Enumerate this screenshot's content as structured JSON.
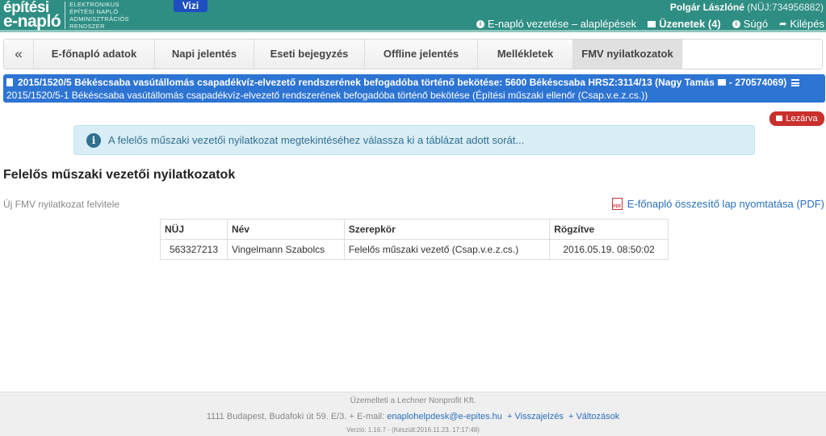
{
  "header": {
    "logo_line1": "építési",
    "logo_line2": "e-napló",
    "logo_sub1": "ELEKTRONIKUS",
    "logo_sub2": "ÉPÍTÉSI NAPLÓ",
    "logo_sub3": "ADMINISZTRÁCIÓS",
    "logo_sub4": "RENDSZER",
    "vizi": "Vizi",
    "user_name": "Polgár Lászlóné",
    "user_id": "(NÜJ:734956882)",
    "nav": {
      "guide": "E-napló vezetése – alaplépések",
      "messages": "Üzenetek (4)",
      "help": "Súgó",
      "logout": "Kilépés"
    }
  },
  "tabs": [
    "«",
    "E-főnapló adatok",
    "Napi jelentés",
    "Eseti bejegyzés",
    "Offline jelentés",
    "Mellékletek",
    "FMV nyilatkozatok"
  ],
  "project": {
    "line1": "2015/1520/5 Békéscsaba vasútállomás csapadékvíz-elvezető rendszerének befogadóba történő bekötése: 5600 Békéscsaba HRSZ:3114/13 (Nagy Tamás",
    "line1_suffix": "- 270574069)",
    "line2": "2015/1520/5-1 Békéscsaba vasútállomás csapadékvíz-elvezető rendszerének befogadóba történő bekötése (Építési műszaki ellenőr (Csap.v.e.z.cs.))"
  },
  "lock_label": "Lezárva",
  "info_text": "A felelős műszaki vezetői nyilatkozat megtekintéséhez válassza ki a táblázat adott sorát...",
  "section_title": "Felelős műszaki vezetői nyilatkozatok",
  "new_fmv": "Új FMV nyilatkozat felvitele",
  "pdf_link": "E-főnapló összesítő lap nyomtatása (PDF)",
  "table": {
    "headers": [
      "NÜJ",
      "Név",
      "Szerepkör",
      "Rögzítve"
    ],
    "rows": [
      [
        "563327213",
        "Vingelmann Szabolcs",
        "Felelős műszaki vezető (Csap.v.e.z.cs.)",
        "2016.05.19. 08:50:02"
      ]
    ]
  },
  "footer": {
    "operator": "Üzemelteti a Lechner Nonprofit Kft.",
    "address": "1111 Budapest, Budafoki út 59. E/3. + E-mail:",
    "email": "enaplohelpdesk@e-epites.hu",
    "feedback": "+ Visszajelzés",
    "changes": "+ Változások",
    "version": "Verzió: 1.16.7 - (Készült:2016.11.23. 17:17:48)"
  },
  "colors": {
    "header_bg": "#2f8e83",
    "project_bar": "#2d74d3",
    "lock": "#c9302c",
    "info_bg": "#d9edf7"
  }
}
